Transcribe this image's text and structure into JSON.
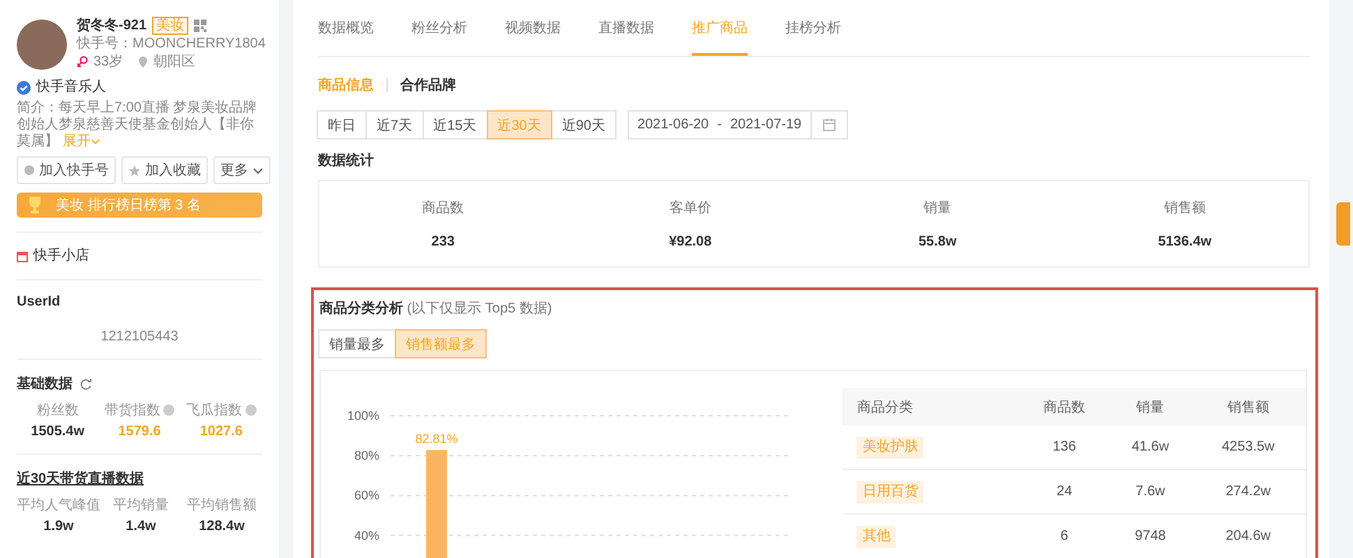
{
  "profile": {
    "name": "贺冬冬-921",
    "tag": "美妆",
    "handle": "快手号：MOONCHERRY1804",
    "age": "33岁",
    "location": "朝阳区",
    "verified_label": "快手音乐人",
    "bio": "简介：每天早上7:00直播 梦泉美妆品牌创始人梦泉慈善天使基金创始人【非你莫属】",
    "expand": "展开",
    "buttons": [
      {
        "kind": "follow",
        "label": "加入快手号"
      },
      {
        "kind": "favorite",
        "label": "加入收藏"
      },
      {
        "kind": "more",
        "label": "更多"
      }
    ],
    "rank_banner": "美妆 排行榜日榜第 3 名",
    "shop": "快手小店"
  },
  "userid": {
    "title": "UserId",
    "value": "1212105443"
  },
  "basic": {
    "title": "基础数据",
    "stats": [
      {
        "label": "粉丝数",
        "value": "1505.4w",
        "highlight": false,
        "info": false
      },
      {
        "label": "带货指数",
        "value": "1579.6",
        "highlight": true,
        "info": true
      },
      {
        "label": "飞瓜指数",
        "value": "1027.6",
        "highlight": true,
        "info": true
      }
    ]
  },
  "live30": {
    "title": "近30天带货直播数据",
    "stats": [
      {
        "label": "平均人气峰值",
        "value": "1.9w"
      },
      {
        "label": "平均销量",
        "value": "1.4w"
      },
      {
        "label": "平均销售额",
        "value": "128.4w"
      }
    ]
  },
  "tabs": [
    {
      "label": "数据概览",
      "selected": false
    },
    {
      "label": "粉丝分析",
      "selected": false
    },
    {
      "label": "视频数据",
      "selected": false
    },
    {
      "label": "直播数据",
      "selected": false
    },
    {
      "label": "推广商品",
      "selected": true
    },
    {
      "label": "挂榜分析",
      "selected": false
    }
  ],
  "subtabs": [
    {
      "label": "商品信息",
      "selected": true
    },
    {
      "label": "合作品牌",
      "selected": false
    }
  ],
  "ranges": [
    {
      "label": "昨日",
      "selected": false
    },
    {
      "label": "近7天",
      "selected": false
    },
    {
      "label": "近15天",
      "selected": false
    },
    {
      "label": "近30天",
      "selected": true
    },
    {
      "label": "近90天",
      "selected": false
    }
  ],
  "date_range": {
    "start": "2021-06-20",
    "separator": "-",
    "end": "2021-07-19"
  },
  "summary": {
    "title": "数据统计",
    "stats": [
      {
        "label": "商品数",
        "value": "233"
      },
      {
        "label": "客单价",
        "value": "¥92.08"
      },
      {
        "label": "销量",
        "value": "55.8w"
      },
      {
        "label": "销售额",
        "value": "5136.4w"
      }
    ]
  },
  "category": {
    "title": "商品分类分析",
    "note": "(以下仅显示 Top5 数据)",
    "toggles": [
      {
        "label": "销量最多",
        "selected": false
      },
      {
        "label": "销售额最多",
        "selected": true
      }
    ],
    "chart_data": {
      "type": "bar",
      "ylim": [
        0,
        100
      ],
      "grid": true,
      "values": [
        82.81
      ],
      "data_labels": true,
      "value_labels": [
        "82.81%"
      ],
      "yticks": [
        {
          "value": 40,
          "label": "40%"
        },
        {
          "value": 60,
          "label": "60%"
        },
        {
          "value": 80,
          "label": "80%"
        },
        {
          "value": 100,
          "label": "100%"
        }
      ]
    },
    "table": {
      "columns": [
        "商品分类",
        "商品数",
        "销量",
        "销售额"
      ],
      "rows": [
        {
          "category": "美妆护肤",
          "count": "136",
          "sales": "41.6w",
          "revenue": "4253.5w"
        },
        {
          "category": "日用百货",
          "count": "24",
          "sales": "7.6w",
          "revenue": "274.2w"
        },
        {
          "category": "其他",
          "count": "6",
          "sales": "9748",
          "revenue": "204.6w"
        }
      ]
    }
  }
}
